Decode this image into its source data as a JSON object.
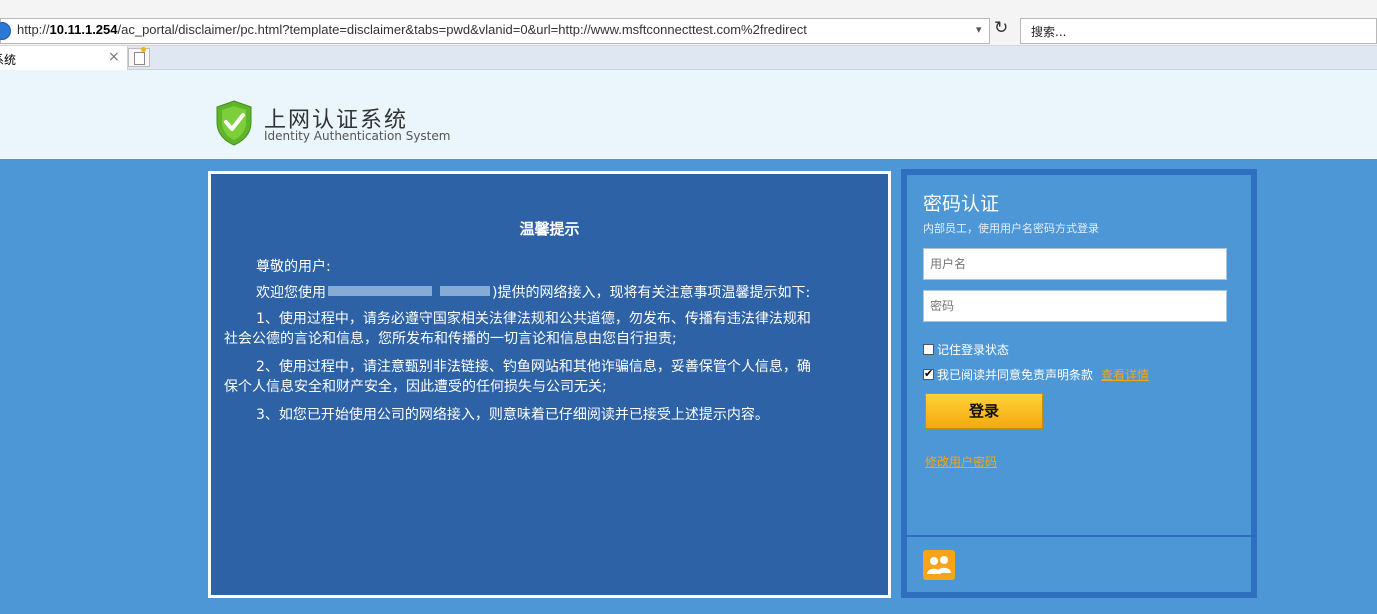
{
  "browser": {
    "url_prefix": "http://",
    "url_host": "10.11.1.254",
    "url_path": "/ac_portal/disclaimer/pc.html?template=disclaimer&tabs=pwd&vlanid=0&url=http://www.msftconnecttest.com%2fredirect",
    "search_placeholder": "搜索...",
    "tab_title": "系统",
    "tab_close": "×",
    "dropdown_glyph": "▾",
    "refresh_glyph": "↻"
  },
  "header": {
    "title_cn": "上网认证系统",
    "title_en": "Identity Authentication System",
    "shield_color": "#6cbf2c"
  },
  "notice": {
    "title": "温馨提示",
    "greeting": "尊敬的用户:",
    "welcome_a": "欢迎您使用",
    "welcome_b": ")提供的网络接入，现将有关注意事项温馨提示如下:",
    "item1_line1": "1、使用过程中，请务必遵守国家相关法律法规和公共道德，勿发布、传播有违法律法规和",
    "item1_line2": "社会公德的言论和信息，您所发布和传播的一切言论和信息由您自行担责;",
    "item2_line1": "2、使用过程中，请注意甄别非法链接、钓鱼网站和其他诈骗信息，妥善保管个人信息，确",
    "item2_line2": "保个人信息安全和财产安全，因此遭受的任何损失与公司无关;",
    "item3": "3、如您已开始使用公司的网络接入，则意味着已仔细阅读并已接受上述提示内容。"
  },
  "login": {
    "title": "密码认证",
    "subtitle": "内部员工，使用用户名密码方式登录",
    "username_placeholder": "用户名",
    "password_placeholder": "密码",
    "remember_label": "记住登录状态",
    "remember_checked": false,
    "agree_label": "我已阅读并同意免责声明条款",
    "agree_checked": true,
    "view_details": "查看详情",
    "login_button": "登录",
    "change_password": "修改用户密码"
  },
  "colors": {
    "accent_blue": "#4d97d6",
    "notice_bg": "#2d62a7",
    "button_orange": "#f4a90f",
    "link_orange": "#f3a51b"
  }
}
